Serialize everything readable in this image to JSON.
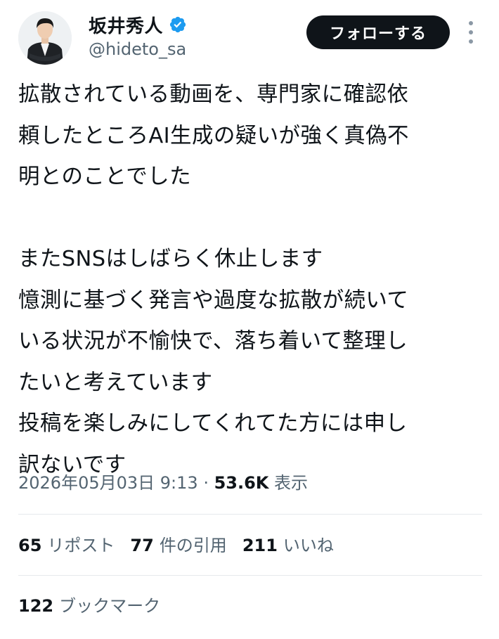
{
  "author": {
    "display_name": "坂井秀人",
    "handle": "@hideto_sa",
    "verified": true,
    "avatar_icon": "person-avatar-icon",
    "verified_icon": "verified-badge-icon",
    "verified_color": "#1d9bf0"
  },
  "actions": {
    "follow_label": "フォローする",
    "more_icon": "more-vertical-icon"
  },
  "tweet": {
    "lines": [
      "拡散されている動画を、専門家に確認依",
      "頼したところAI生成の疑いが強く真偽不",
      "明とのことでした",
      "",
      "またSNSはしばらく休止します",
      "憶測に基づく発言や過度な拡散が続いて",
      "いる状況が不愉快で、落ち着いて整理し",
      "たいと考えています",
      "投稿を楽しみにしてくれてた方には申し",
      "訳ないです"
    ]
  },
  "meta": {
    "timestamp": "2026年05月03日 9:13",
    "separator": " · ",
    "views_count": "53.6K",
    "views_label": "表示"
  },
  "stats": {
    "reposts": {
      "count": "65",
      "label": "リポスト"
    },
    "quotes": {
      "count": "77",
      "label": "件の引用"
    },
    "likes": {
      "count": "211",
      "label": "いいね"
    },
    "bookmarks": {
      "count": "122",
      "label": "ブックマーク"
    }
  },
  "colors": {
    "text_primary": "#0f1419",
    "text_secondary": "#536471",
    "follow_button_bg": "#0f1419",
    "divider": "#e6e9ec"
  }
}
